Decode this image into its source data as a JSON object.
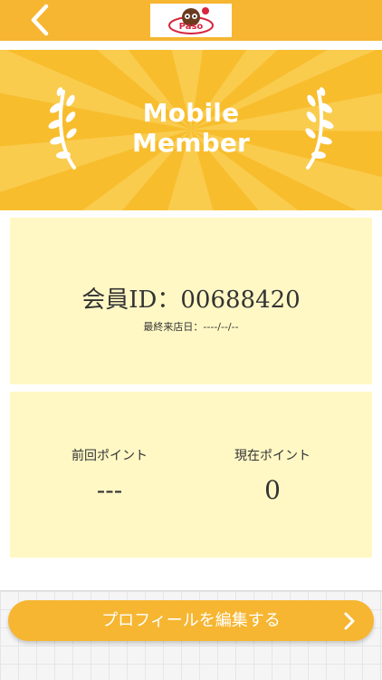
{
  "header": {
    "back_icon": "chevron-left-icon",
    "logo_text": "Paso",
    "bar_color": "#f6b632"
  },
  "hero": {
    "title_line1": "Mobile",
    "title_line2": "Member",
    "left_icon": "laurel-left-icon",
    "right_icon": "laurel-right-icon",
    "background_color": "#f8bd2d"
  },
  "member": {
    "id_text": "会員ID：00688420",
    "last_visit": "最終来店日：----/--/--"
  },
  "points": {
    "previous_label": "前回ポイント",
    "previous_value": "---",
    "current_label": "現在ポイント",
    "current_value": "0"
  },
  "footer": {
    "edit_profile_label": "プロフィールを編集する",
    "chevron_icon": "chevron-right-icon"
  }
}
